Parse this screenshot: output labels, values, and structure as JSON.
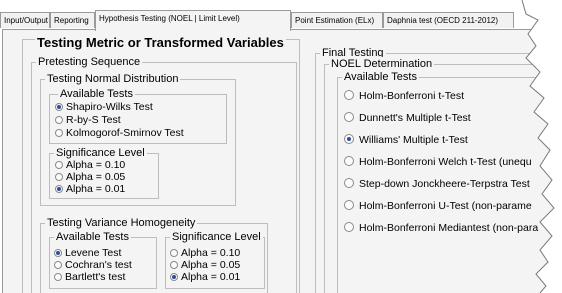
{
  "tabs": [
    {
      "label": "Input/Output",
      "active": false
    },
    {
      "label": "Reporting",
      "active": false
    },
    {
      "label": "Hypothesis Testing (NOEL | Limit Level)",
      "active": true
    },
    {
      "label": "Point Estimation (ELx)",
      "active": false
    },
    {
      "label": "Daphnia test (OECD 211-2012)",
      "active": false
    }
  ],
  "testing_metric": {
    "title": "Testing Metric or Transformed Variables",
    "pretesting": {
      "title": "Pretesting Sequence",
      "normal": {
        "title": "Testing Normal Distribution",
        "tests": {
          "title": "Available Tests",
          "options": [
            {
              "label": "Shapiro-Wilks Test",
              "selected": true
            },
            {
              "label": "R-by-S Test",
              "selected": false
            },
            {
              "label": "Kolmogorof-Smirnov Test",
              "selected": false
            }
          ]
        },
        "significance": {
          "title": "Significance Level",
          "options": [
            {
              "label": "Alpha = 0.10",
              "selected": false
            },
            {
              "label": "Alpha = 0.05",
              "selected": false
            },
            {
              "label": "Alpha = 0.01",
              "selected": true
            }
          ]
        }
      },
      "variance": {
        "title": "Testing Variance Homogeneity",
        "tests": {
          "title": "Available Tests",
          "options": [
            {
              "label": "Levene Test",
              "selected": true
            },
            {
              "label": "Cochran's test",
              "selected": false
            },
            {
              "label": "Bartlett's test",
              "selected": false
            }
          ]
        },
        "significance": {
          "title": "Significance Level",
          "options": [
            {
              "label": "Alpha = 0.10",
              "selected": false
            },
            {
              "label": "Alpha = 0.05",
              "selected": false
            },
            {
              "label": "Alpha = 0.01",
              "selected": true
            }
          ]
        }
      }
    }
  },
  "final_testing": {
    "title": "Final Testing",
    "noel": {
      "title": "NOEL Determination",
      "tests": {
        "title": "Available Tests",
        "options": [
          {
            "label": "Holm-Bonferroni t-Test",
            "selected": false
          },
          {
            "label": "Dunnett's Multiple t-Test",
            "selected": false
          },
          {
            "label": "Williams' Multiple t-Test",
            "selected": true
          },
          {
            "label": "Holm-Bonferroni Welch t-Test (unequ",
            "selected": false
          },
          {
            "label": "Step-down Jonckheere-Terpstra Test",
            "selected": false
          },
          {
            "label": "Holm-Bonferroni U-Test (non-parame",
            "selected": false
          },
          {
            "label": "Holm-Bonferroni Mediantest (non-para",
            "selected": false
          }
        ]
      }
    }
  },
  "colors": {
    "panel": "#f4f4f4",
    "border": "#bdbdbd",
    "radio_selected": "#2b4f9e"
  }
}
